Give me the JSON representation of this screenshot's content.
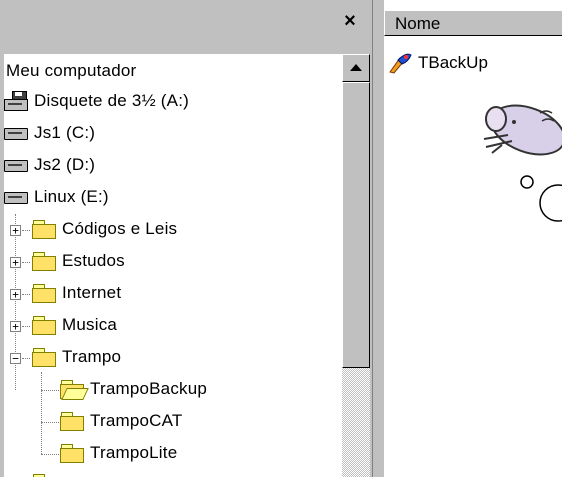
{
  "left_pane": {
    "close_label": "×",
    "tree": [
      {
        "label": "Meu computador",
        "icon": "none",
        "indent": 0
      },
      {
        "label": "Disquete de 3½ (A:)",
        "icon": "floppy-icon",
        "indent": 0
      },
      {
        "label": "Js1 (C:)",
        "icon": "drive-icon",
        "indent": 0
      },
      {
        "label": "Js2 (D:)",
        "icon": "drive-icon",
        "indent": 0
      },
      {
        "label": "Linux (E:)",
        "icon": "drive-icon",
        "indent": 0
      },
      {
        "label": "Códigos e Leis",
        "icon": "folder-icon",
        "indent": 1,
        "expander": "+"
      },
      {
        "label": "Estudos",
        "icon": "folder-icon",
        "indent": 1,
        "expander": "+"
      },
      {
        "label": "Internet",
        "icon": "folder-icon",
        "indent": 1,
        "expander": "+"
      },
      {
        "label": "Musica",
        "icon": "folder-icon",
        "indent": 1,
        "expander": "+"
      },
      {
        "label": "Trampo",
        "icon": "folder-icon",
        "indent": 1,
        "expander": "−"
      },
      {
        "label": "TrampoBackup",
        "icon": "folder-open-icon",
        "indent": 2
      },
      {
        "label": "TrampoCAT",
        "icon": "folder-icon",
        "indent": 2
      },
      {
        "label": "TrampoLite",
        "icon": "folder-icon",
        "indent": 2
      }
    ]
  },
  "right_pane": {
    "column_header": "Nome",
    "files": [
      {
        "label": "TBackUp",
        "icon": "tbackup-app-icon"
      }
    ]
  },
  "colors": {
    "window_face": "#c0c0c0",
    "content_bg": "#ffffff",
    "folder_yellow": "#ffe168"
  }
}
